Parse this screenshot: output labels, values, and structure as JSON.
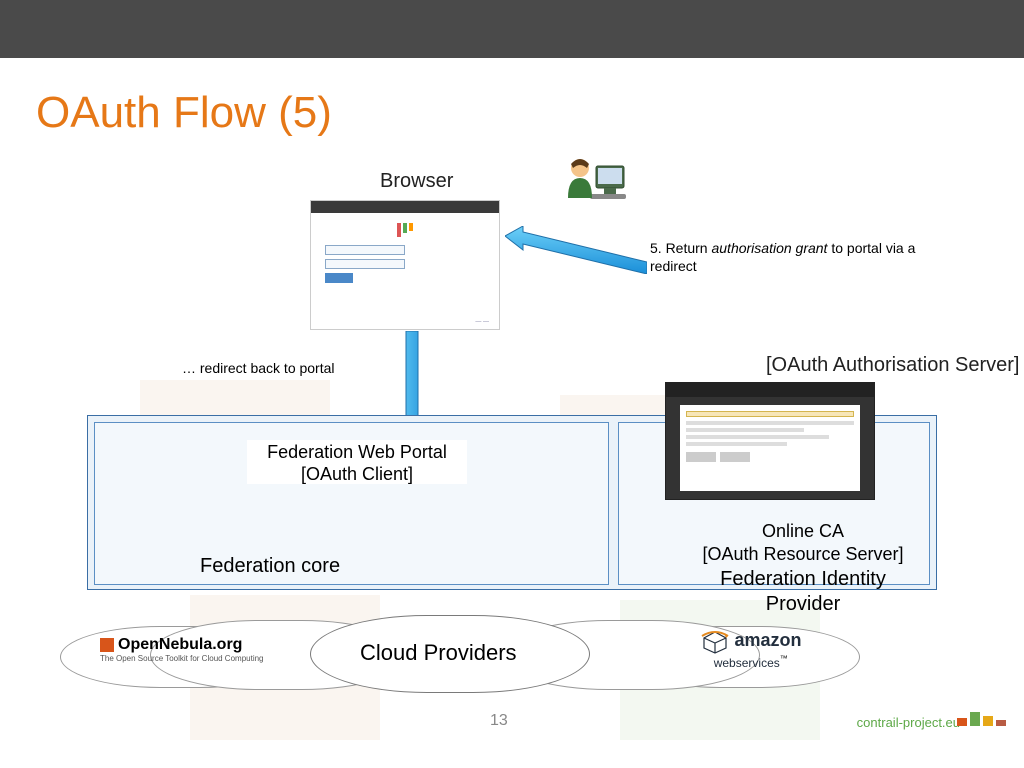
{
  "title": "OAuth Flow (5)",
  "browser_label": "Browser",
  "step5": {
    "prefix": "5.  Return ",
    "italic": "authorisation grant",
    "suffix": " to portal via a redirect"
  },
  "redirect_label": "…  redirect back to portal",
  "oauth_server_label": "[OAuth Authorisation Server]",
  "federation": {
    "portal_line1": "Federation Web Portal",
    "portal_line2": "[OAuth Client]",
    "core_label": "Federation core",
    "online_ca_line1": "Online CA",
    "online_ca_line2": "[OAuth Resource Server]",
    "idp_label": "Federation Identity Provider"
  },
  "cloud_providers_label": "Cloud Providers",
  "opennebula": {
    "name": "OpenNebula.org",
    "tagline": "The Open Source Toolkit for Cloud Computing"
  },
  "aws": {
    "name": "amazon",
    "sub": "webservices",
    "tm": "™"
  },
  "page_number": "13",
  "footer_url": "contrail-project.eu",
  "colors": {
    "title": "#E67817",
    "arrow_fill": "#33B0F0",
    "arrow_stroke": "#1F6FA8",
    "fed_border": "#3A6EA5",
    "fed_bg": "#EAF2F9"
  }
}
